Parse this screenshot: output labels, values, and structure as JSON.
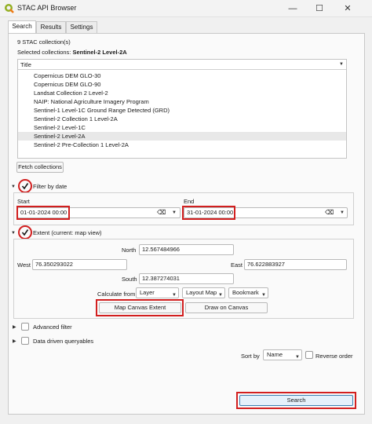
{
  "window": {
    "title": "STAC API Browser",
    "minimize": "—",
    "maximize": "☐",
    "close": "✕"
  },
  "tabs": [
    "Search",
    "Results",
    "Settings"
  ],
  "collections": {
    "count_text": "9 STAC collection(s)",
    "selected_label": "Selected collections:",
    "selected_value": "Sentinel-2 Level-2A",
    "column_header": "Title",
    "items": [
      "Copernicus DEM GLO-30",
      "Copernicus DEM GLO-90",
      "Landsat Collection 2 Level-2",
      "NAIP: National Agriculture Imagery Program",
      "Sentinel-1 Level-1C Ground Range Detected (GRD)",
      "Sentinel-2 Collection 1 Level-2A",
      "Sentinel-2 Level-1C",
      "Sentinel-2 Level-2A",
      "Sentinel-2 Pre-Collection 1 Level-2A"
    ],
    "selected_index": 7,
    "fetch_button": "Fetch collections"
  },
  "date_filter": {
    "label": "Filter by date",
    "start_label": "Start",
    "start_value": "01-01-2024 00:00",
    "end_label": "End",
    "end_value": "31-01-2024 00:00"
  },
  "extent": {
    "label": "Extent (current: map view)",
    "north_label": "North",
    "north_value": "12.567484966",
    "west_label": "West",
    "west_value": "76.350293022",
    "east_label": "East",
    "east_value": "76.622883927",
    "south_label": "South",
    "south_value": "12.387274031",
    "calculate_label": "Calculate from",
    "layer_label": "Layer",
    "layout_map_label": "Layout Map",
    "bookmark_label": "Bookmark",
    "map_canvas_button": "Map Canvas Extent",
    "draw_canvas_button": "Draw on Canvas"
  },
  "advanced_filter": "Advanced filter",
  "queryables": "Data driven queryables",
  "sort": {
    "label": "Sort by",
    "value": "Name",
    "reverse_label": "Reverse order"
  },
  "search_button": "Search",
  "colors": {
    "highlight": "#d21f1f",
    "checkmark": "#1a1a1a"
  }
}
